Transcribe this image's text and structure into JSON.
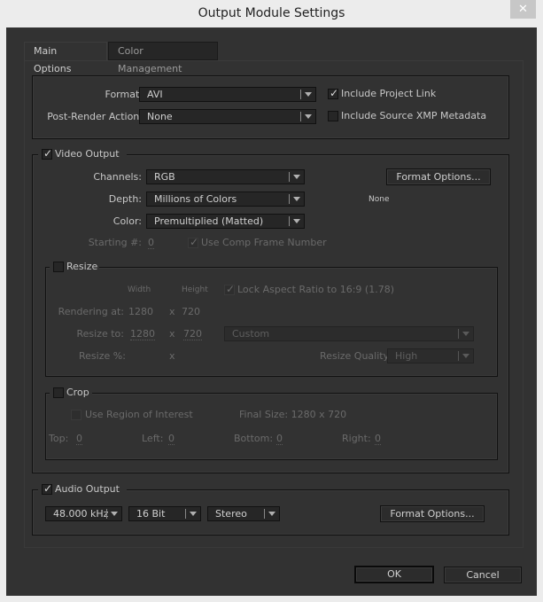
{
  "window": {
    "title": "Output Module Settings",
    "close_glyph": "✕"
  },
  "tabs": [
    {
      "label": "Main Options",
      "active": true
    },
    {
      "label": "Color Management",
      "active": false
    }
  ],
  "general": {
    "format_label": "Format:",
    "format_value": "AVI",
    "post_render_label": "Post-Render Action:",
    "post_render_value": "None",
    "include_project_link": {
      "label": "Include Project Link",
      "checked": true
    },
    "include_xmp": {
      "label": "Include Source XMP Metadata",
      "checked": false
    }
  },
  "video": {
    "legend": "Video Output",
    "checked": true,
    "channels_label": "Channels:",
    "channels_value": "RGB",
    "depth_label": "Depth:",
    "depth_value": "Millions of Colors",
    "color_label": "Color:",
    "color_value": "Premultiplied (Matted)",
    "starting_label": "Starting #:",
    "starting_value": "0",
    "use_comp_frame": {
      "label": "Use Comp Frame Number",
      "checked": true,
      "disabled": true
    },
    "format_options_label": "Format Options...",
    "format_info": "None"
  },
  "resize": {
    "legend": "Resize",
    "checked": false,
    "width_header": "Width",
    "height_header": "Height",
    "lock_aspect": {
      "label": "Lock Aspect Ratio to 16:9 (1.78)",
      "checked": true,
      "disabled": true
    },
    "rendering_label": "Rendering at:",
    "rendering_w": "1280",
    "rendering_h": "720",
    "resize_to_label": "Resize to:",
    "resize_w": "1280",
    "resize_h": "720",
    "x": "x",
    "preset_value": "Custom",
    "percent_label": "Resize %:",
    "quality_label": "Resize Quality:",
    "quality_value": "High"
  },
  "crop": {
    "legend": "Crop",
    "checked": false,
    "roi": {
      "label": "Use Region of Interest",
      "checked": false,
      "disabled": true
    },
    "final_size": "Final Size: 1280 x 720",
    "top_label": "Top:",
    "top_value": "0",
    "left_label": "Left:",
    "left_value": "0",
    "bottom_label": "Bottom:",
    "bottom_value": "0",
    "right_label": "Right:",
    "right_value": "0"
  },
  "audio": {
    "legend": "Audio Output",
    "checked": true,
    "rate_value": "48.000 kHz",
    "bits_value": "16 Bit",
    "channels_value": "Stereo",
    "format_options_label": "Format Options..."
  },
  "footer": {
    "ok_label": "OK",
    "cancel_label": "Cancel"
  }
}
